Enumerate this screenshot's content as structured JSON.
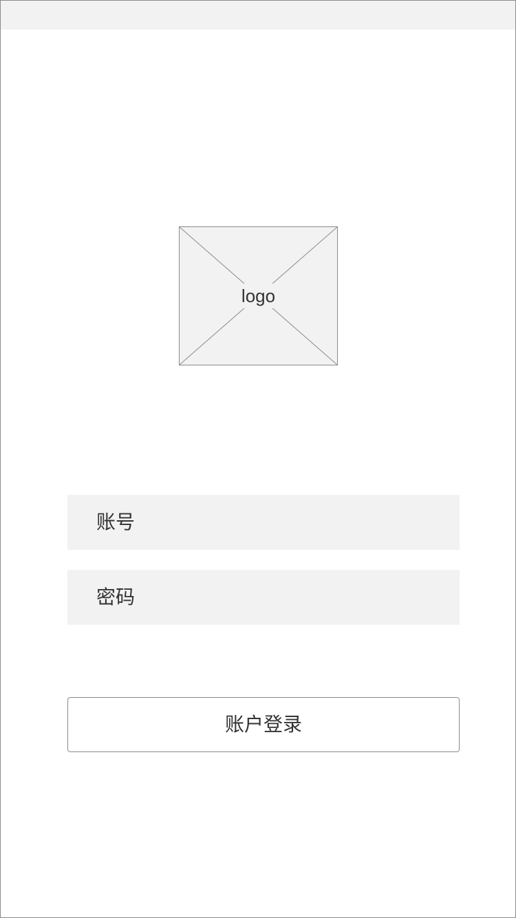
{
  "logo": {
    "label": "logo"
  },
  "form": {
    "account_label": "账号",
    "password_label": "密码",
    "login_button": "账户登录"
  },
  "colors": {
    "background": "#ffffff",
    "field_fill": "#f2f2f2",
    "border": "#8a8a8a",
    "text": "#333333"
  }
}
